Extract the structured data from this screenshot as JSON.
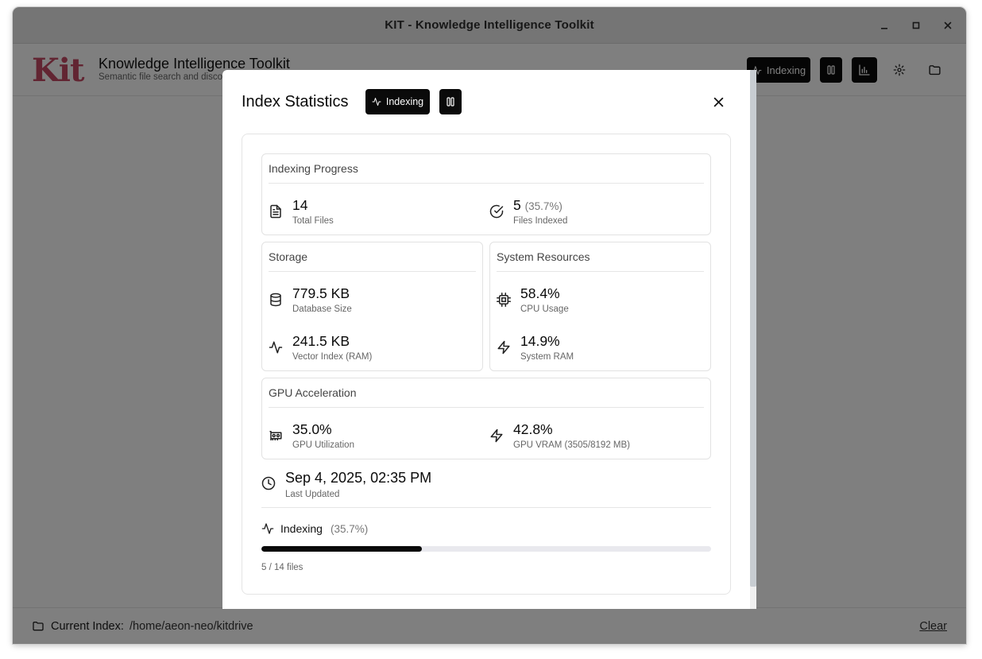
{
  "window": {
    "title": "KIT - Knowledge Intelligence Toolkit"
  },
  "header": {
    "logo_text": "Kit",
    "title": "Knowledge Intelligence Toolkit",
    "subtitle": "Semantic file search and discovery",
    "indexing_label": "Indexing"
  },
  "footer": {
    "current_index_label": "Current Index:",
    "path": "/home/aeon-neo/kitdrive",
    "clear_label": "Clear"
  },
  "modal": {
    "title": "Index Statistics",
    "badge_label": "Indexing",
    "indexing_progress": {
      "title": "Indexing Progress",
      "total_files": {
        "value": "14",
        "label": "Total Files"
      },
      "files_indexed": {
        "value": "5",
        "percent": "(35.7%)",
        "label": "Files Indexed"
      }
    },
    "storage": {
      "title": "Storage",
      "database_size": {
        "value": "779.5 KB",
        "label": "Database Size"
      },
      "vector_index": {
        "value": "241.5 KB",
        "label": "Vector Index (RAM)"
      }
    },
    "system_resources": {
      "title": "System Resources",
      "cpu": {
        "value": "58.4%",
        "label": "CPU Usage"
      },
      "ram": {
        "value": "14.9%",
        "label": "System RAM"
      }
    },
    "gpu": {
      "title": "GPU Acceleration",
      "utilization": {
        "value": "35.0%",
        "label": "GPU Utilization"
      },
      "vram": {
        "value": "42.8%",
        "label": "GPU VRAM (3505/8192 MB)"
      }
    },
    "last_updated": {
      "value": "Sep 4, 2025, 02:35 PM",
      "label": "Last Updated"
    },
    "progress": {
      "label": "Indexing",
      "percent_text": "(35.7%)",
      "fraction": 0.357,
      "files_text": "5 / 14 files"
    }
  },
  "colors": {
    "logo": "#c44a64",
    "accent": "#0a0a0a",
    "track": "#e9e9ee"
  },
  "icons": [
    "minimize-icon",
    "maximize-icon",
    "close-icon",
    "activity-icon",
    "pause-icon",
    "bar-chart-icon",
    "gear-icon",
    "folder-icon",
    "file-text-icon",
    "check-circle-icon",
    "database-icon",
    "cpu-icon",
    "zap-icon",
    "gpu-card-icon",
    "clock-icon"
  ]
}
